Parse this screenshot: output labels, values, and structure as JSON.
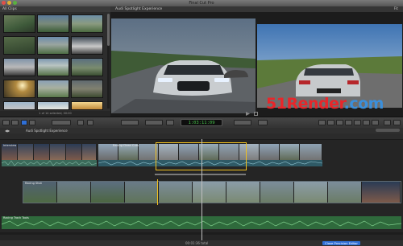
{
  "window": {
    "title": "Final Cut Pro"
  },
  "browser": {
    "title": "All Clips",
    "status": "1 of 14 selected, 00:00"
  },
  "viewer": {
    "title": "Audi Spotlight Experience",
    "zoom": "Fit"
  },
  "toolbar": {
    "timecode": "1:03:11:09"
  },
  "timeline": {
    "project_title": "Audi Spotlight Experience",
    "clip_labels": {
      "interview": "Interview",
      "spotlight": "Racing Clean Cuts",
      "secondary": "Racing Shot",
      "music": "Racing Track Tools"
    }
  },
  "status_bar": {
    "duration": "00:01:36 total",
    "precision_button": "Close Precision Editor"
  },
  "watermark": {
    "prefix": "51Render",
    "suffix": ".com",
    "prefix_color": "#e8262a",
    "suffix_color": "#3a8fdc"
  },
  "colors": {
    "window_bg": "#2a2a2a",
    "accent_blue": "#2f6fd6",
    "audio_green": "#3b6a5a",
    "timecode_green": "#46c24a",
    "secondary_storyline": "#f0c020"
  }
}
